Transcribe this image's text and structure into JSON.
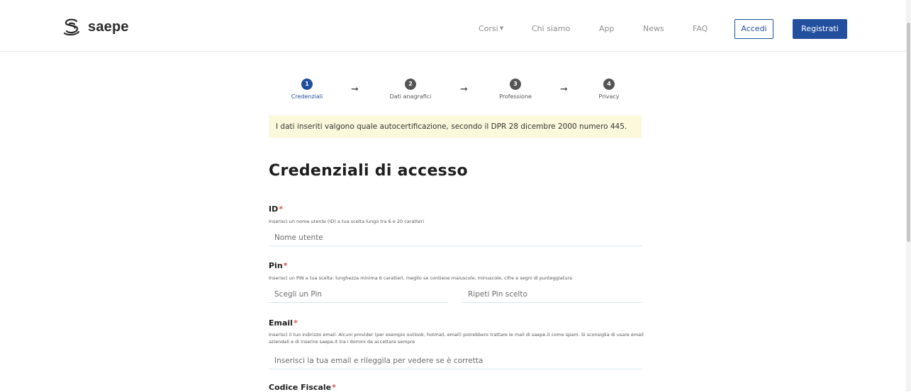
{
  "brand": {
    "name": "saepe"
  },
  "nav": {
    "items": [
      {
        "label": "Corsi",
        "dropdown": true
      },
      {
        "label": "Chi siamo"
      },
      {
        "label": "App"
      },
      {
        "label": "News"
      },
      {
        "label": "FAQ"
      }
    ],
    "login_label": "Accedi",
    "register_label": "Registrati"
  },
  "steps": [
    {
      "number": "1",
      "label": "Credenziali",
      "active": true
    },
    {
      "number": "2",
      "label": "Dati anagrafici",
      "active": false
    },
    {
      "number": "3",
      "label": "Professione",
      "active": false
    },
    {
      "number": "4",
      "label": "Privacy",
      "active": false
    }
  ],
  "notice": "I dati inseriti valgono quale autocertificazione, secondo il DPR 28 dicembre 2000 numero 445.",
  "form": {
    "title": "Credenziali di accesso",
    "required_mark": "*",
    "id": {
      "label": "ID",
      "help": "Inserisci un nome utente (ID) a tua scelta lungo tra 6 e 20 caratteri",
      "placeholder": "Nome utente",
      "value": ""
    },
    "pin": {
      "label": "Pin",
      "help": "Inserisci un PIN a tua scelta: lunghezza minima 6 caratteri, meglio se contiene maiuscole, minuscole, cifre e segni di punteggiatura",
      "placeholder": "Scegli un Pin",
      "repeat_placeholder": "Ripeti Pin scelto",
      "value": "",
      "repeat_value": ""
    },
    "email": {
      "label": "Email",
      "help": "Inserisci il tuo indirizzo email. Alcuni provider (per esempio outlook, hotmail, email) potrebbero trattare le mail di saepe.it come spam. Si sconsiglia di usare email aziendali e di inserire saepe.it tra i domini da accettare sempre",
      "placeholder": "Inserisci la tua email e rileggila per vedere se è corretta",
      "value": ""
    },
    "codice_fiscale": {
      "label": "Codice Fiscale"
    }
  },
  "colors": {
    "primary": "#234f9f",
    "step_active": "#1f4e9b",
    "step_inactive": "#555555",
    "notice_bg": "#fcf8dc",
    "required": "#d9534f"
  }
}
